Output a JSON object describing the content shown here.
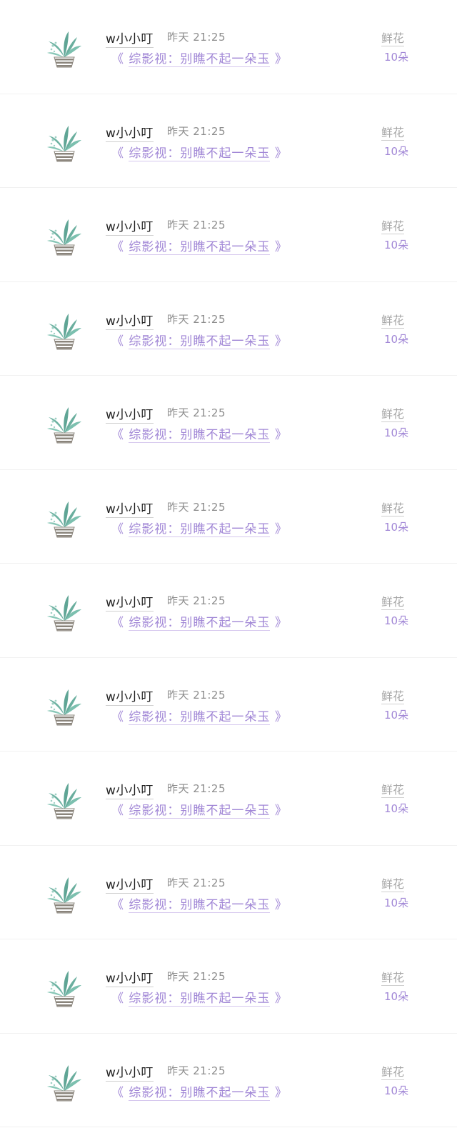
{
  "rows": [
    {
      "user": "w小小叮",
      "time": "昨天 21:25",
      "book_open": "《",
      "book_title": "综影视：别瞧不起一朵玉",
      "book_close": "》",
      "gift_label": "鲜花",
      "gift_count": "10朵"
    },
    {
      "user": "w小小叮",
      "time": "昨天 21:25",
      "book_open": "《",
      "book_title": "综影视：别瞧不起一朵玉",
      "book_close": "》",
      "gift_label": "鲜花",
      "gift_count": "10朵"
    },
    {
      "user": "w小小叮",
      "time": "昨天 21:25",
      "book_open": "《",
      "book_title": "综影视：别瞧不起一朵玉",
      "book_close": "》",
      "gift_label": "鲜花",
      "gift_count": "10朵"
    },
    {
      "user": "w小小叮",
      "time": "昨天 21:25",
      "book_open": "《",
      "book_title": "综影视：别瞧不起一朵玉",
      "book_close": "》",
      "gift_label": "鲜花",
      "gift_count": "10朵"
    },
    {
      "user": "w小小叮",
      "time": "昨天 21:25",
      "book_open": "《",
      "book_title": "综影视：别瞧不起一朵玉",
      "book_close": "》",
      "gift_label": "鲜花",
      "gift_count": "10朵"
    },
    {
      "user": "w小小叮",
      "time": "昨天 21:25",
      "book_open": "《",
      "book_title": "综影视：别瞧不起一朵玉",
      "book_close": "》",
      "gift_label": "鲜花",
      "gift_count": "10朵"
    },
    {
      "user": "w小小叮",
      "time": "昨天 21:25",
      "book_open": "《",
      "book_title": "综影视：别瞧不起一朵玉",
      "book_close": "》",
      "gift_label": "鲜花",
      "gift_count": "10朵"
    },
    {
      "user": "w小小叮",
      "time": "昨天 21:25",
      "book_open": "《",
      "book_title": "综影视：别瞧不起一朵玉",
      "book_close": "》",
      "gift_label": "鲜花",
      "gift_count": "10朵"
    },
    {
      "user": "w小小叮",
      "time": "昨天 21:25",
      "book_open": "《",
      "book_title": "综影视：别瞧不起一朵玉",
      "book_close": "》",
      "gift_label": "鲜花",
      "gift_count": "10朵"
    },
    {
      "user": "w小小叮",
      "time": "昨天 21:25",
      "book_open": "《",
      "book_title": "综影视：别瞧不起一朵玉",
      "book_close": "》",
      "gift_label": "鲜花",
      "gift_count": "10朵"
    },
    {
      "user": "w小小叮",
      "time": "昨天 21:25",
      "book_open": "《",
      "book_title": "综影视：别瞧不起一朵玉",
      "book_close": "》",
      "gift_label": "鲜花",
      "gift_count": "10朵"
    },
    {
      "user": "w小小叮",
      "time": "昨天 21:25",
      "book_open": "《",
      "book_title": "综影视：别瞧不起一朵玉",
      "book_close": "》",
      "gift_label": "鲜花",
      "gift_count": "10朵"
    }
  ],
  "avatar": {
    "icon": "potted-plant-icon",
    "leaf_color": "#6fb3a3",
    "pot_color": "#8a847b"
  },
  "colors": {
    "accent": "#a187d6",
    "name": "#222222",
    "muted": "#8c8c8c"
  }
}
